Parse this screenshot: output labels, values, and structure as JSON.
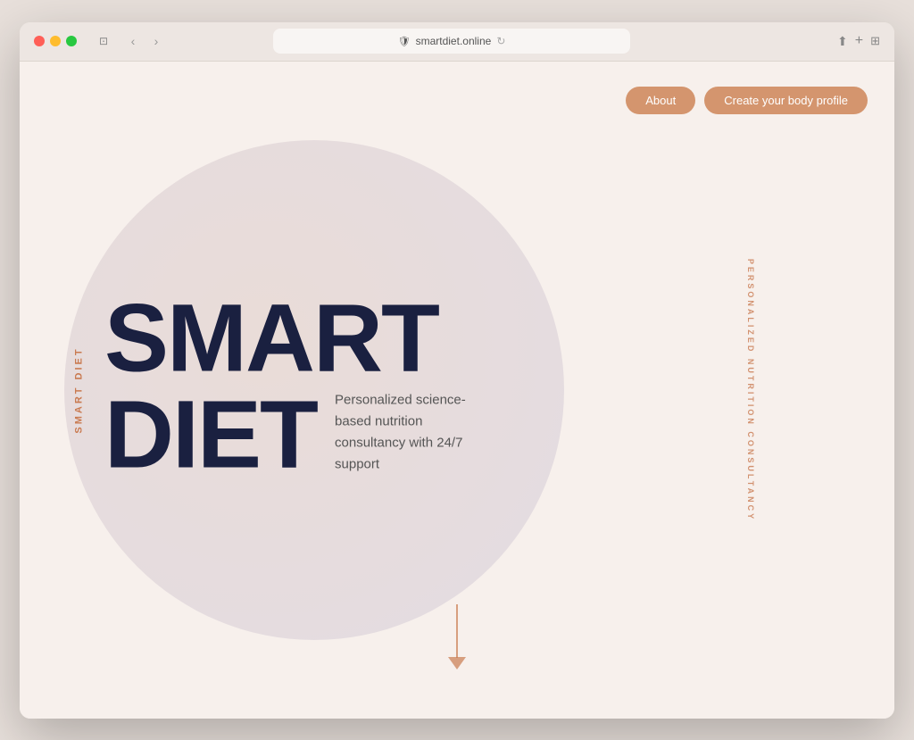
{
  "browser": {
    "url": "smartdiet.online",
    "title": "Smart Diet"
  },
  "nav": {
    "about_label": "About",
    "profile_label": "Create your body profile"
  },
  "hero": {
    "title_line1": "SMART",
    "title_line2": "DIET",
    "subtitle": "Personalized science-based nutrition consultancy with 24/7 support"
  },
  "side_left": {
    "text": "SMART DIET"
  },
  "side_right": {
    "text": "PERSONALIZED NUTRITION CONSULTANCY"
  }
}
